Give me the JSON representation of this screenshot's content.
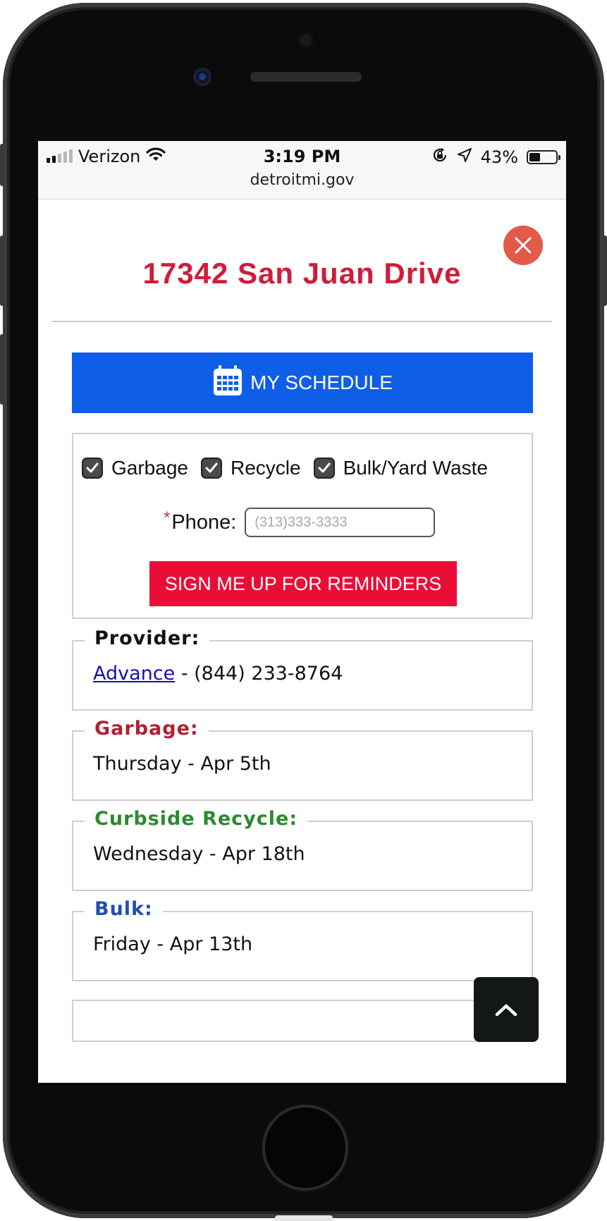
{
  "status_bar": {
    "carrier": "Verizon",
    "time": "3:19 PM",
    "url": "detroitmi.gov",
    "battery": "43%",
    "battery_level": 0.43
  },
  "header": {
    "address": "17342 San Juan Drive",
    "address_color": "#d01c3c"
  },
  "schedule_button": {
    "label": "MY SCHEDULE",
    "color": "#0e5ee8"
  },
  "signup": {
    "checkboxes": [
      {
        "label": "Garbage",
        "checked": true
      },
      {
        "label": "Recycle",
        "checked": true
      },
      {
        "label": "Bulk/Yard Waste",
        "checked": true
      }
    ],
    "required_mark": "*",
    "phone_label": "Phone:",
    "phone_placeholder": "(313)333-3333",
    "phone_value": "",
    "button_label": "SIGN ME UP FOR REMINDERS",
    "button_color": "#ec0d37"
  },
  "provider": {
    "legend": "Provider:",
    "legend_color": "#111111",
    "name": "Advance",
    "link_color": "#1a0dab",
    "phone": " - (844) 233-8764"
  },
  "garbage": {
    "legend": "Garbage:",
    "legend_color": "#b22033",
    "value": "Thursday - Apr 5th"
  },
  "recycle": {
    "legend": "Curbside Recycle:",
    "legend_color": "#2b8a2e",
    "value": "Wednesday - Apr 18th"
  },
  "bulk": {
    "legend": "Bulk:",
    "legend_color": "#2050b0",
    "value": "Friday - Apr 13th"
  },
  "icons": {
    "close": "close-icon",
    "calendar": "calendar-icon",
    "scroll_top": "chevron-up-icon",
    "wifi": "wifi-icon",
    "orientation_lock": "orientation-lock-icon",
    "location": "location-arrow-icon"
  }
}
